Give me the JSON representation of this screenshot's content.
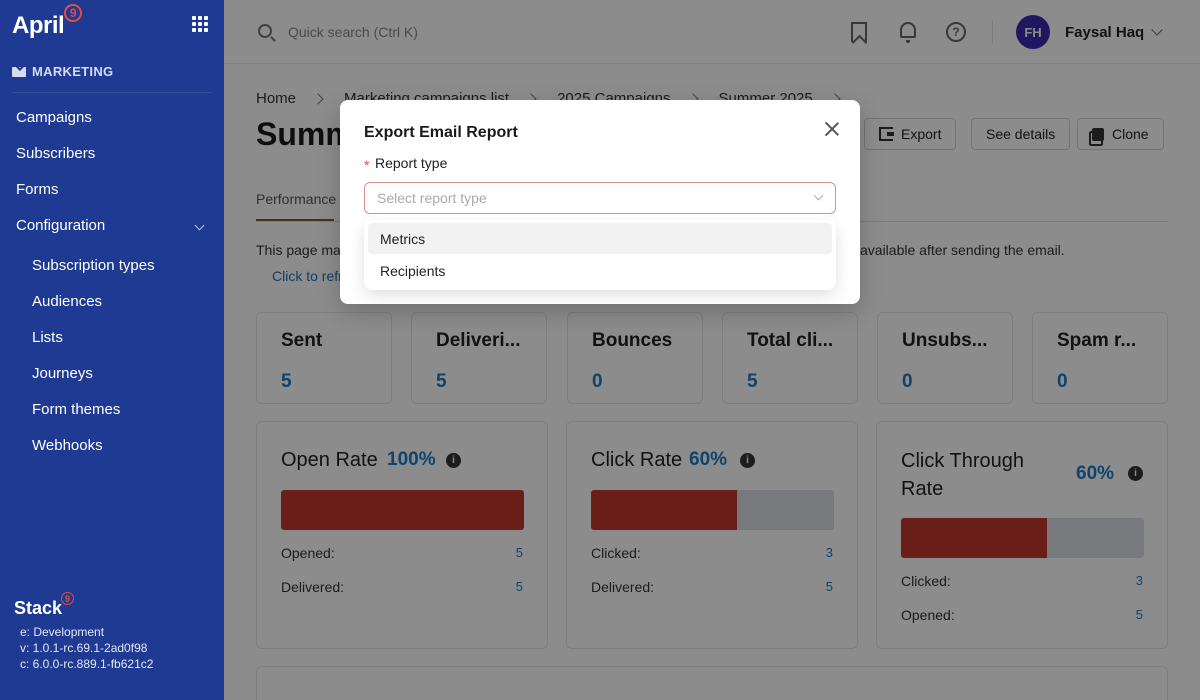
{
  "app": {
    "logo": "April",
    "logo_badge": "9",
    "footer_logo": "Stack",
    "footer_badge": "9"
  },
  "sidebar": {
    "section": "MARKETING",
    "items": [
      {
        "label": "Campaigns"
      },
      {
        "label": "Subscribers"
      },
      {
        "label": "Forms"
      },
      {
        "label": "Configuration"
      }
    ],
    "subitems": [
      {
        "label": "Subscription types"
      },
      {
        "label": "Audiences"
      },
      {
        "label": "Lists"
      },
      {
        "label": "Journeys"
      },
      {
        "label": "Form themes"
      },
      {
        "label": "Webhooks"
      }
    ],
    "version": {
      "env": "e: Development",
      "v": "v: 1.0.1-rc.69.1-2ad0f98",
      "c": "c: 6.0.0-rc.889.1-fb621c2"
    }
  },
  "topbar": {
    "search_placeholder": "Quick search (Ctrl K)",
    "avatar_initials": "FH",
    "username": "Faysal Haq"
  },
  "breadcrumb": [
    "Home",
    "Marketing campaigns list",
    "2025 Campaigns",
    "Summer 2025"
  ],
  "page": {
    "title": "Summ",
    "buttons": {
      "export": "Export",
      "details": "See details",
      "clone": "Clone"
    },
    "tab": "Performance",
    "info_left": "This page may",
    "info_right": "available after sending the email.",
    "refresh_link": "Click to refr"
  },
  "stats": [
    {
      "title": "Sent",
      "value": "5"
    },
    {
      "title": "Deliveri...",
      "value": "5"
    },
    {
      "title": "Bounces",
      "value": "0"
    },
    {
      "title": "Total cli...",
      "value": "5"
    },
    {
      "title": "Unsubs...",
      "value": "0"
    },
    {
      "title": "Spam r...",
      "value": "0"
    }
  ],
  "rates": [
    {
      "title": "Open Rate",
      "pct": "100%",
      "fill": 1.0,
      "rows": [
        {
          "label": "Opened:",
          "value": "5"
        },
        {
          "label": "Delivered:",
          "value": "5"
        }
      ]
    },
    {
      "title": "Click Rate",
      "pct": "60%",
      "fill": 0.6,
      "rows": [
        {
          "label": "Clicked:",
          "value": "3"
        },
        {
          "label": "Delivered:",
          "value": "5"
        }
      ]
    },
    {
      "title_line1": "Click Through",
      "title_line2": "Rate",
      "pct": "60%",
      "fill": 0.6,
      "rows": [
        {
          "label": "Clicked:",
          "value": "3"
        },
        {
          "label": "Opened:",
          "value": "5"
        }
      ]
    }
  ],
  "modal": {
    "title": "Export Email Report",
    "required_mark": "*",
    "field_label": "Report type",
    "placeholder": "Select report type",
    "options": [
      "Metrics",
      "Recipients"
    ]
  }
}
